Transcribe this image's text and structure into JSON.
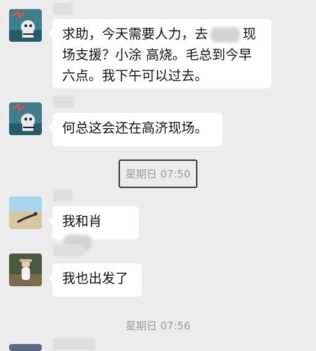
{
  "messages": {
    "m1": {
      "line1_a": "求助，今天需要人力，去",
      "line1_b": "现",
      "line2": "场支援？小涂 高烧。毛总到今早",
      "line3": "六点。我下午可以过去。"
    },
    "m2": {
      "text": "何总这会还在高济现场。"
    },
    "time1": "星期日 07:50",
    "m3": {
      "text": "我和肖"
    },
    "m4": {
      "text": "我也出发了"
    },
    "time2": "星期日 07:56"
  }
}
